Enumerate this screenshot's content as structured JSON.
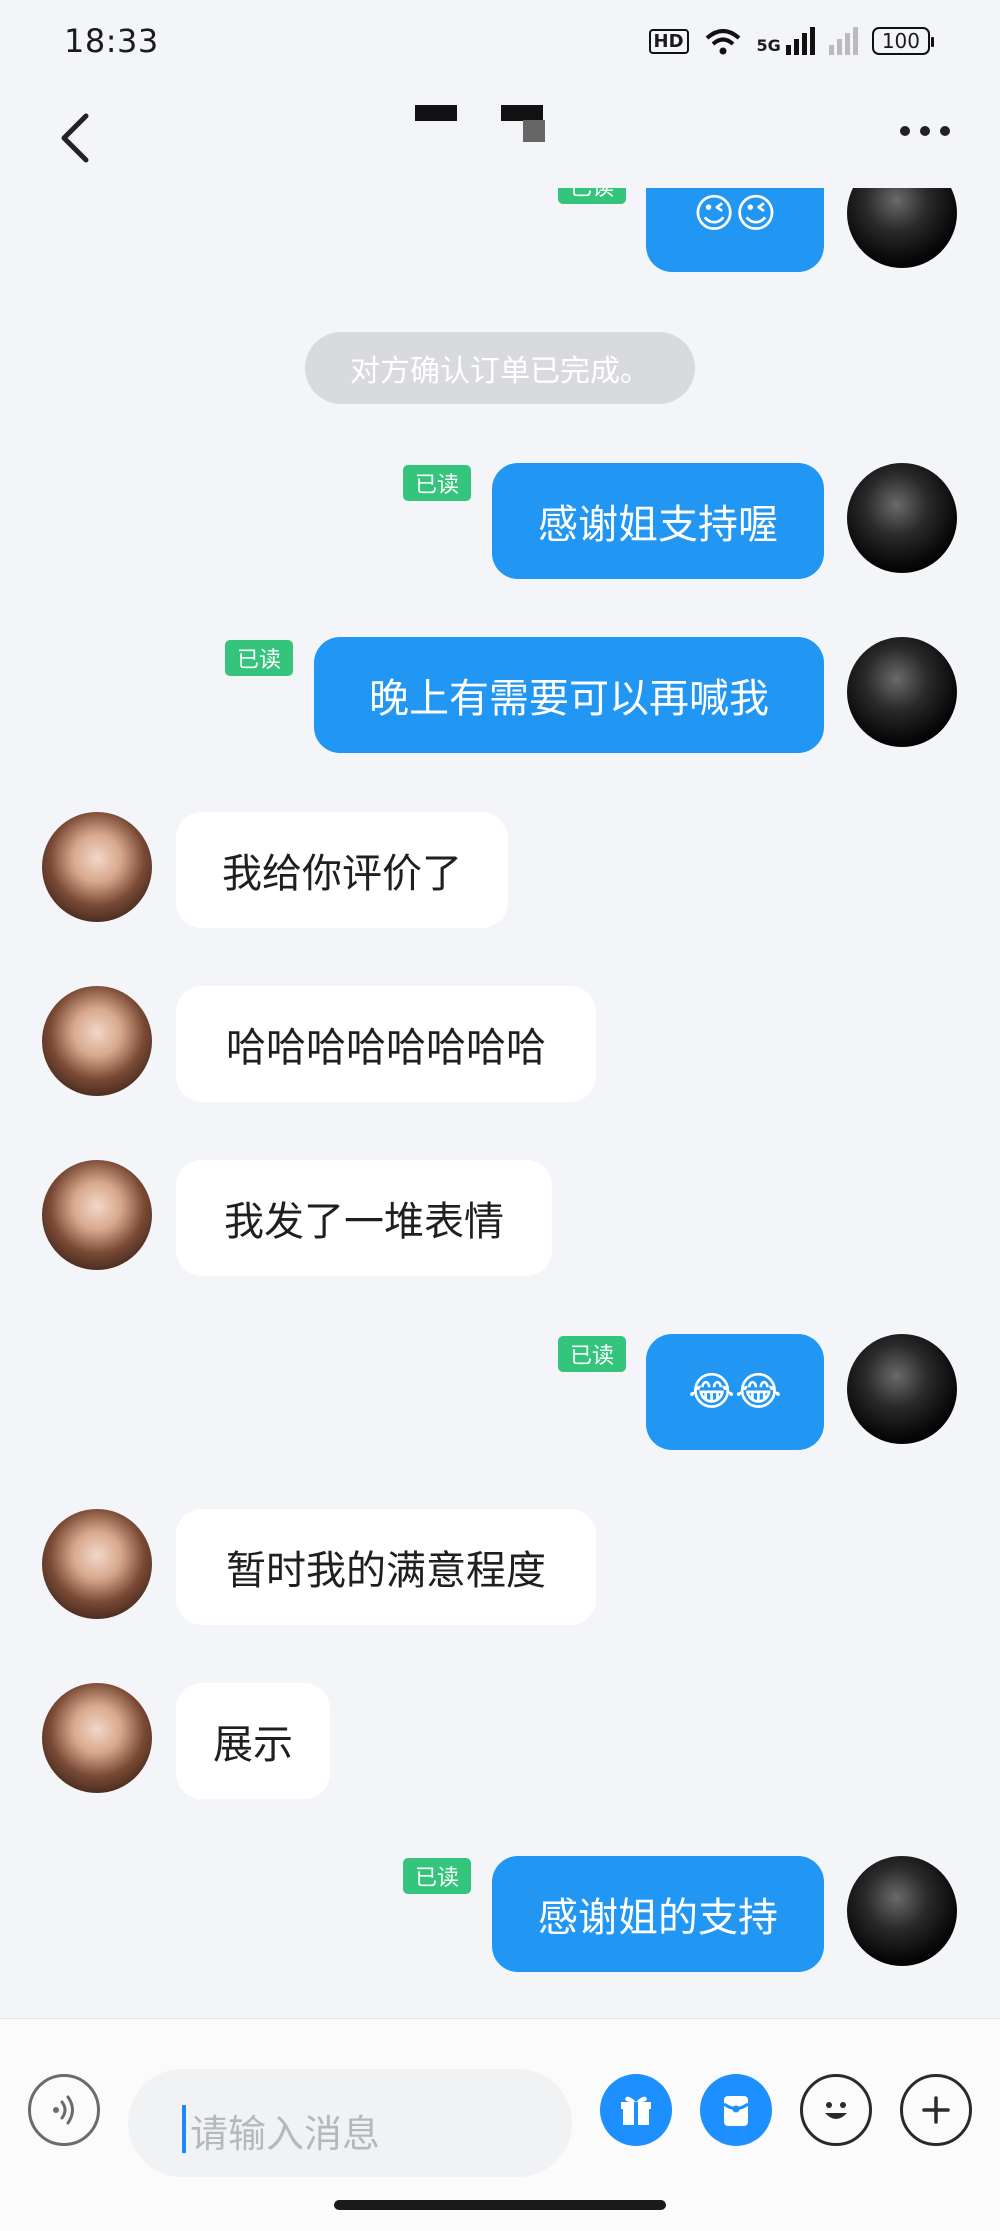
{
  "status_bar": {
    "time": "18:33",
    "hd_label": "HD",
    "network_label": "5G",
    "battery": "100"
  },
  "header": {
    "back_icon": "chevron-left-icon",
    "more_icon": "more-horizontal-icon"
  },
  "system_notice": "对方确认订单已完成。",
  "read_label": "已读",
  "messages": [
    {
      "side": "out",
      "text": "😉😉",
      "read": true
    },
    {
      "side": "out",
      "text": "感谢姐支持喔",
      "read": true
    },
    {
      "side": "out",
      "text": "晚上有需要可以再喊我",
      "read": true
    },
    {
      "side": "in",
      "text": "我给你评价了"
    },
    {
      "side": "in",
      "text": "哈哈哈哈哈哈哈哈"
    },
    {
      "side": "in",
      "text": "我发了一堆表情"
    },
    {
      "side": "out",
      "text": "😂😂",
      "read": true
    },
    {
      "side": "in",
      "text": "暂时我的满意程度"
    },
    {
      "side": "in",
      "text": "展示"
    },
    {
      "side": "out",
      "text": "感谢姐的支持",
      "read": true
    }
  ],
  "input_bar": {
    "placeholder": "请输入消息",
    "icons": [
      "voice-icon",
      "gift-icon",
      "red-packet-icon",
      "emoji-icon",
      "plus-icon"
    ]
  },
  "colors": {
    "outgoing_bubble": "#2196f3",
    "incoming_bubble": "#ffffff",
    "read_badge": "#34c47c",
    "background": "#f3f5f9",
    "accent": "#1e8fff"
  }
}
